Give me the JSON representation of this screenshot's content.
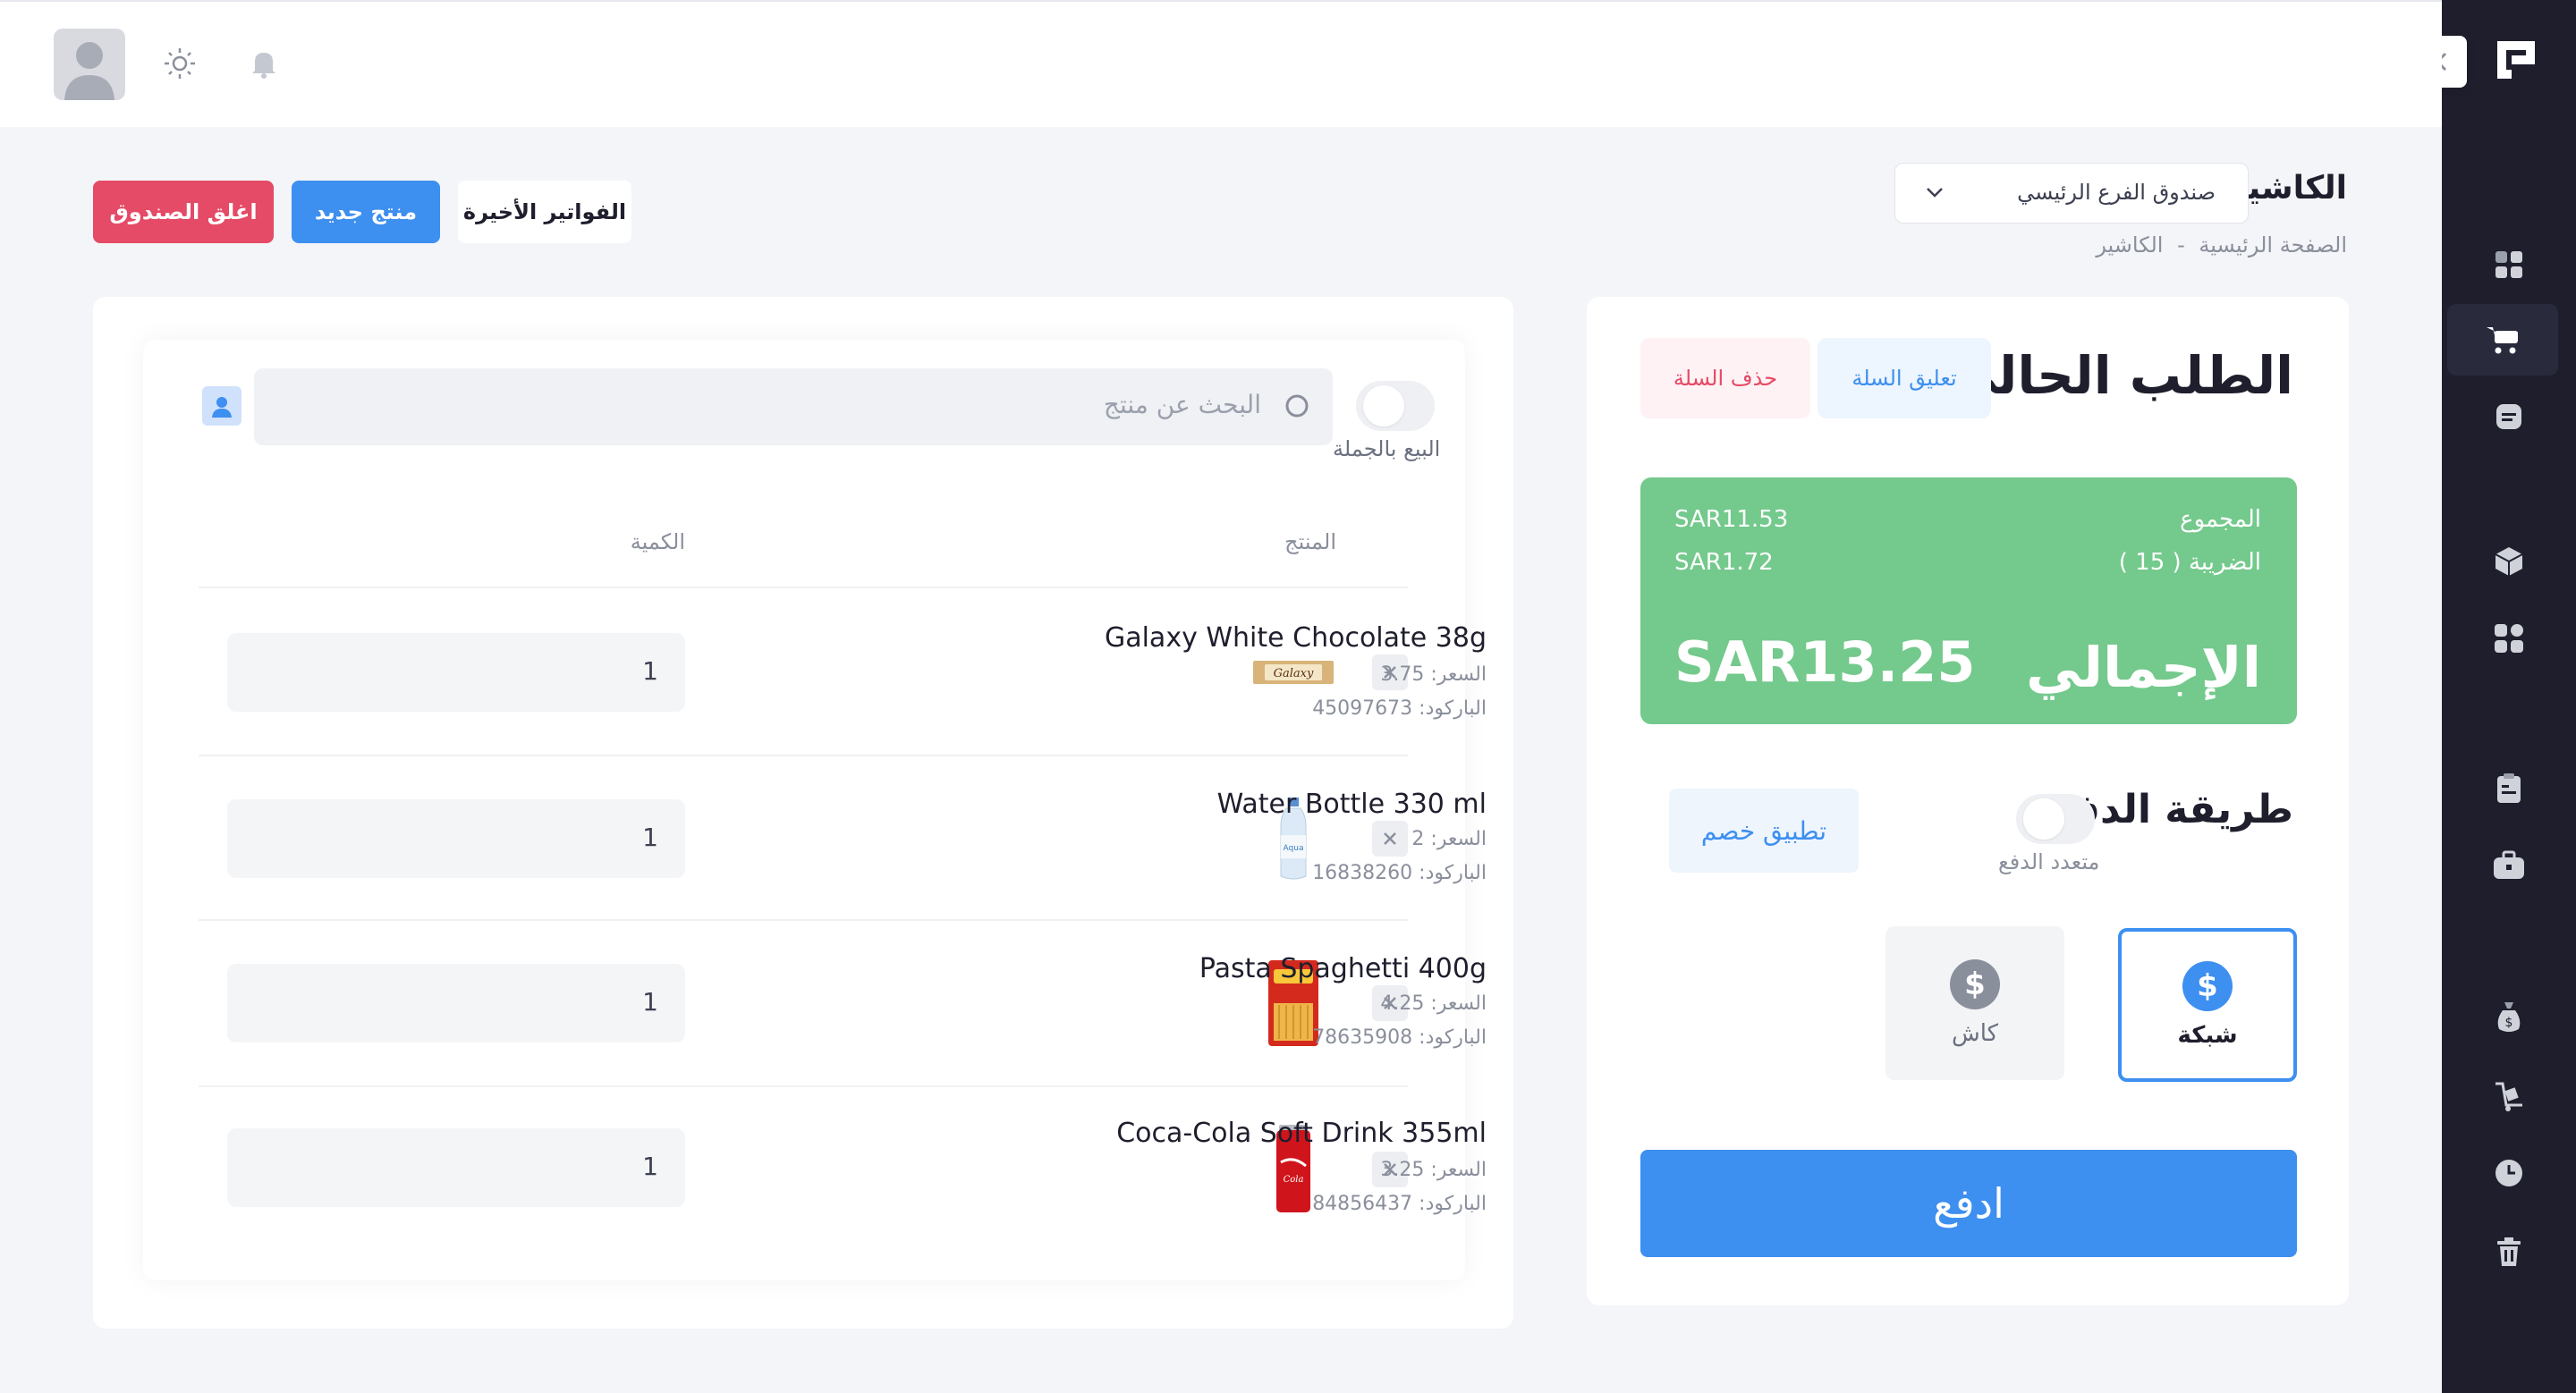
{
  "header": {
    "user_avatar_alt": "user"
  },
  "page": {
    "title": "الكاشير",
    "cash_drawer_select": "صندوق الفرع الرئيسي",
    "breadcrumb": [
      "الصفحة الرئيسية",
      "-",
      "الكاشير"
    ],
    "buttons": {
      "recent_invoices": "الفواتير الأخيرة",
      "new_product": "منتج جديد",
      "close_drawer": "اغلق الصندوق"
    }
  },
  "products_panel": {
    "wholesale_label": "البيع بالجملة",
    "search_placeholder": "البحث عن منتج",
    "columns": {
      "product": "المنتج",
      "quantity": "الكمية"
    },
    "items": [
      {
        "name": "Galaxy White Chocolate 38g",
        "price": "السعر: 3.75",
        "barcode": "الباركود: 45097673",
        "qty": "1"
      },
      {
        "name": "Water Bottle 330 ml",
        "price": "السعر: 2",
        "barcode": "الباركود: 16838260",
        "qty": "1"
      },
      {
        "name": "Pasta Spaghetti 400g",
        "price": "السعر: 4.25",
        "barcode": "الباركود: 78635908",
        "qty": "1"
      },
      {
        "name": "Coca-Cola Soft Drink 355ml",
        "price": "السعر: 3.25",
        "barcode": "الباركود: 84856437",
        "qty": "1"
      }
    ]
  },
  "order_panel": {
    "title": "الطلب الحالي",
    "hold_cart": "تعليق السلة",
    "clear_cart": "حذف السلة",
    "totals": {
      "subtotal_label": "المجموع",
      "subtotal_value": "SAR11.53",
      "tax_label": "الضريبة ( 15 )",
      "tax_value": "SAR1.72",
      "grand_label": "الإجمالي",
      "grand_value": "SAR13.25"
    },
    "payment_title": "طريقة الدفع",
    "multi_payment_label": "متعدد الدفع",
    "apply_discount": "تطبيق خصم",
    "methods": [
      {
        "label": "شبكة",
        "selected": true
      },
      {
        "label": "كاش",
        "selected": false
      }
    ],
    "pay_button": "ادفع"
  },
  "colors": {
    "sidebar": "#1e1e2d",
    "primary": "#3d8ff0",
    "danger": "#e54a66",
    "success": "#74c98c"
  },
  "icons": [
    "logo-icon",
    "collapse-chevron-icon",
    "dashboard-icon",
    "cart-icon",
    "invoice-icon",
    "box-icon",
    "apps-icon",
    "clipboard-icon",
    "briefcase-icon",
    "money-bag-icon",
    "trolley-icon",
    "clock-icon",
    "trash-icon",
    "sun-icon",
    "bell-icon",
    "search-icon",
    "user-icon",
    "close-icon",
    "dollar-icon",
    "chevron-down-icon"
  ]
}
